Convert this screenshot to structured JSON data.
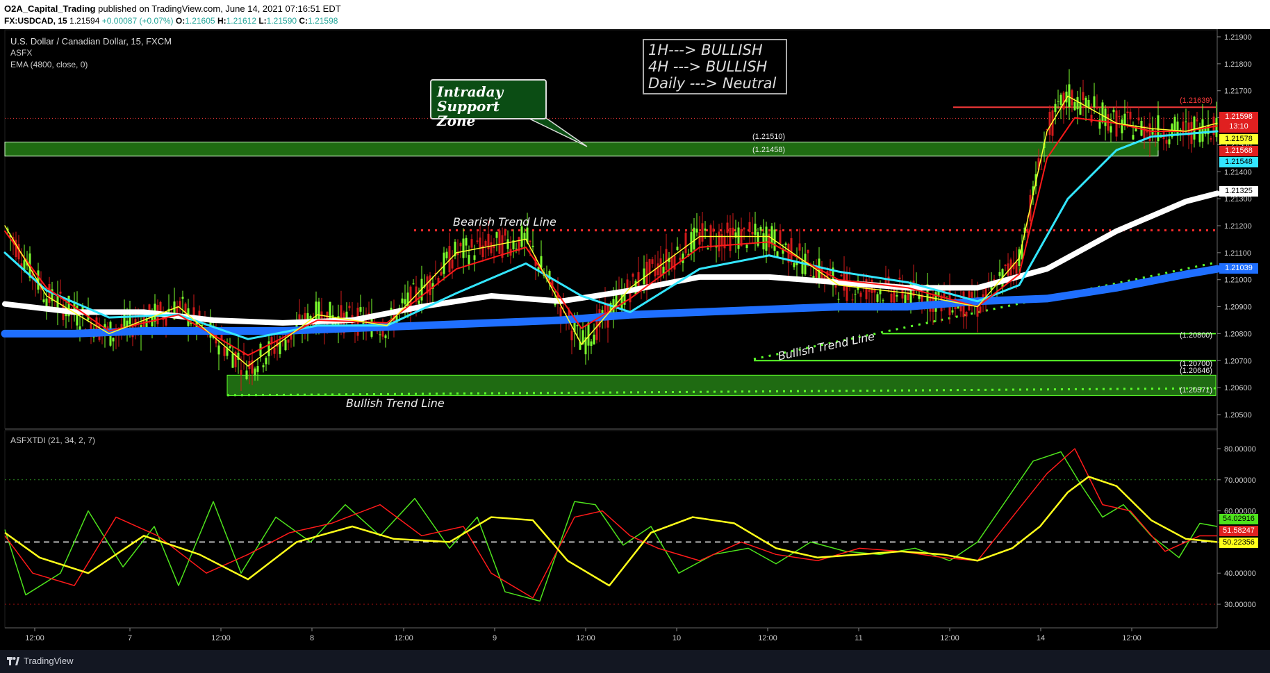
{
  "header": {
    "publisher": "O2A_Capital_Trading",
    "published_text": "published on TradingView.com, June 14, 2021 07:16:51 EDT",
    "symbol": "FX:USDCAD, 15",
    "last": "1.21594",
    "change": "+0.00087 (+0.07%)",
    "o_label": "O:",
    "o": "1.21605",
    "h_label": "H:",
    "h": "1.21612",
    "l_label": "L:",
    "l": "1.21590",
    "c_label": "C:",
    "c": "1.21598"
  },
  "main_pane": {
    "title": "U.S. Dollar / Canadian Dollar, 15, FXCM",
    "indicator1": "ASFX",
    "indicator2": "EMA (4800, close, 0)"
  },
  "sub_pane": {
    "title": "ASFXTDI (21, 34, 2, 7)"
  },
  "annotations": {
    "bias_lines": [
      "1H---> BULLISH",
      "4H ---> BULLISH",
      "Daily ---> Neutral"
    ],
    "callout_lines": [
      "Intraday",
      "Support Zone"
    ],
    "bearish_trend_line": "Bearish Trend Line",
    "bullish_trend_line_1": "Bullish Trend Line",
    "bullish_trend_line_2": "Bullish Trend Line",
    "zone_top_label": "(1.21510)",
    "zone_bottom_label": "(1.21458)",
    "resistance_label": "(1.21639)",
    "support_label_1": "(1.20800)",
    "support_label_2": "(1.20700)",
    "support_label_3": "(1.20646)",
    "support_label_4": "(1.20571)"
  },
  "price_tags": {
    "last_price": "1.21598",
    "countdown": "13:10",
    "ema_yellow": "1.21578",
    "ema_red": "1.21568",
    "ema_cyan": "1.21548",
    "ema_white": "1.21325",
    "ema_blue": "1.21039",
    "tdi_green": "54.02916",
    "tdi_red": "51.58247",
    "tdi_yellow": "50.22356"
  },
  "colors": {
    "candle_up": "#7cff2e",
    "candle_down": "#d11a1a",
    "ema_yellow": "#ffff2e",
    "ema_red": "#ff1a1a",
    "ema_cyan": "#33e6ff",
    "ema_white": "#ffffff",
    "ema_blue": "#1f6fff",
    "zone_fill": "#1f6b12",
    "resistance": "#ff3b3b",
    "support": "#5cff2a",
    "tdi_green": "#4ee31c",
    "tdi_red": "#ff1a1a",
    "tdi_yellow": "#ffff1a"
  },
  "footer": {
    "brand": "TradingView"
  },
  "chart_data": [
    {
      "type": "line",
      "title": "U.S. Dollar / Canadian Dollar, 15, FXCM",
      "x_tick_labels": [
        "12:00",
        "7",
        "12:00",
        "8",
        "12:00",
        "9",
        "12:00",
        "10",
        "12:00",
        "11",
        "12:00",
        "14",
        "12:00"
      ],
      "y_tick_labels": [
        "1.21900",
        "1.21800",
        "1.21700",
        "1.21600",
        "1.21500",
        "1.21400",
        "1.21300",
        "1.21200",
        "1.21100",
        "1.21000",
        "1.20900",
        "1.20800",
        "1.20700",
        "1.20600",
        "1.20500"
      ],
      "ylim": [
        1.2046,
        1.2193
      ],
      "grid": false,
      "series": [
        {
          "name": "EMA (4800, close, 0)",
          "color": "#1f6fff",
          "x": [
            0,
            100,
            200,
            300,
            400,
            500,
            600,
            700,
            800,
            900,
            1000,
            1100,
            1200,
            1300,
            1400,
            1500,
            1600,
            1700,
            1745
          ],
          "values": [
            1.208,
            1.208,
            1.2081,
            1.2081,
            1.2081,
            1.2082,
            1.2083,
            1.2084,
            1.2085,
            1.2087,
            1.2088,
            1.2089,
            1.209,
            1.209,
            1.2092,
            1.2093,
            1.2097,
            1.2102,
            1.2104
          ]
        },
        {
          "name": "EMA white",
          "color": "#ffffff",
          "x": [
            0,
            100,
            200,
            300,
            400,
            500,
            600,
            700,
            800,
            900,
            1000,
            1100,
            1200,
            1300,
            1400,
            1500,
            1600,
            1700,
            1745
          ],
          "values": [
            1.2091,
            1.2088,
            1.2088,
            1.2085,
            1.2084,
            1.2085,
            1.209,
            1.2094,
            1.2092,
            1.2096,
            1.2101,
            1.2101,
            1.2099,
            1.2097,
            1.2097,
            1.2104,
            1.2118,
            1.2129,
            1.2132
          ]
        },
        {
          "name": "EMA cyan",
          "color": "#33e6ff",
          "x": [
            0,
            60,
            150,
            250,
            350,
            450,
            550,
            650,
            750,
            830,
            900,
            1000,
            1100,
            1200,
            1300,
            1400,
            1460,
            1530,
            1600,
            1650,
            1700,
            1745
          ],
          "values": [
            1.211,
            1.2096,
            1.2086,
            1.2087,
            1.2078,
            1.2083,
            1.2083,
            1.2095,
            1.2106,
            1.2094,
            1.2088,
            1.2104,
            1.2109,
            1.2103,
            1.2099,
            1.2092,
            1.2098,
            1.213,
            1.2148,
            1.2153,
            1.2154,
            1.2155
          ]
        },
        {
          "name": "EMA red",
          "color": "#ff1a1a",
          "x": [
            0,
            60,
            150,
            250,
            350,
            450,
            550,
            650,
            750,
            830,
            900,
            1000,
            1100,
            1200,
            1300,
            1400,
            1460,
            1500,
            1540,
            1600,
            1650,
            1700,
            1745
          ],
          "values": [
            1.2118,
            1.2097,
            1.2081,
            1.2087,
            1.2072,
            1.2085,
            1.2084,
            1.2104,
            1.2112,
            1.2082,
            1.2093,
            1.2112,
            1.2114,
            1.21,
            1.2097,
            1.209,
            1.2102,
            1.2145,
            1.216,
            1.2158,
            1.2155,
            1.2155,
            1.2157
          ]
        },
        {
          "name": "EMA yellow",
          "color": "#ffff2e",
          "x": [
            0,
            60,
            150,
            250,
            350,
            450,
            550,
            650,
            750,
            830,
            900,
            1000,
            1100,
            1200,
            1300,
            1400,
            1460,
            1500,
            1530,
            1600,
            1650,
            1700,
            1745
          ],
          "values": [
            1.212,
            1.2094,
            1.208,
            1.209,
            1.2068,
            1.2087,
            1.2083,
            1.211,
            1.2115,
            1.2076,
            1.2097,
            1.2116,
            1.2116,
            1.2098,
            1.2095,
            1.209,
            1.2108,
            1.2155,
            1.2168,
            1.2158,
            1.2156,
            1.2155,
            1.2158
          ]
        }
      ]
    },
    {
      "type": "line",
      "title": "ASFXTDI (21, 34, 2, 7)",
      "y_tick_labels": [
        "80.00000",
        "70.00000",
        "60.00000",
        "50.00000",
        "40.00000",
        "30.00000"
      ],
      "ylim": [
        25,
        85
      ],
      "grid": false,
      "reference_lines": [
        70,
        50,
        30
      ],
      "series": [
        {
          "name": "TDI yellow",
          "color": "#ffff1a",
          "x": [
            0,
            50,
            120,
            200,
            280,
            350,
            420,
            500,
            560,
            640,
            700,
            760,
            810,
            870,
            930,
            990,
            1050,
            1110,
            1170,
            1230,
            1290,
            1350,
            1400,
            1450,
            1490,
            1530,
            1560,
            1600,
            1650,
            1700,
            1745
          ],
          "values": [
            53,
            45,
            40,
            52,
            46,
            38,
            50,
            55,
            51,
            50,
            58,
            57,
            44,
            36,
            53,
            58,
            56,
            48,
            45,
            46,
            47,
            46,
            44,
            48,
            55,
            66,
            71,
            68,
            57,
            51,
            50
          ]
        },
        {
          "name": "TDI red",
          "color": "#ff1a1a",
          "x": [
            0,
            40,
            100,
            160,
            220,
            290,
            350,
            410,
            470,
            540,
            600,
            660,
            700,
            760,
            820,
            860,
            900,
            940,
            1000,
            1060,
            1110,
            1170,
            1230,
            1290,
            1350,
            1400,
            1450,
            1500,
            1540,
            1580,
            1620,
            1670,
            1720,
            1745
          ],
          "values": [
            52,
            40,
            36,
            58,
            52,
            40,
            46,
            53,
            56,
            62,
            52,
            55,
            40,
            32,
            58,
            60,
            52,
            48,
            44,
            50,
            46,
            44,
            48,
            47,
            45,
            44,
            58,
            72,
            80,
            62,
            60,
            47,
            52,
            52
          ]
        },
        {
          "name": "TDI green",
          "color": "#4ee31c",
          "x": [
            0,
            30,
            80,
            120,
            170,
            215,
            250,
            300,
            340,
            390,
            440,
            490,
            540,
            590,
            640,
            680,
            720,
            770,
            820,
            850,
            890,
            930,
            970,
            1020,
            1070,
            1110,
            1160,
            1210,
            1260,
            1310,
            1360,
            1400,
            1440,
            1480,
            1520,
            1550,
            1580,
            1610,
            1650,
            1690,
            1720,
            1745
          ],
          "values": [
            54,
            33,
            40,
            60,
            42,
            55,
            36,
            63,
            40,
            58,
            50,
            62,
            52,
            64,
            48,
            58,
            34,
            31,
            63,
            62,
            49,
            55,
            40,
            46,
            48,
            43,
            50,
            47,
            46,
            48,
            44,
            50,
            63,
            76,
            79,
            68,
            58,
            62,
            52,
            45,
            56,
            55
          ]
        }
      ]
    }
  ]
}
